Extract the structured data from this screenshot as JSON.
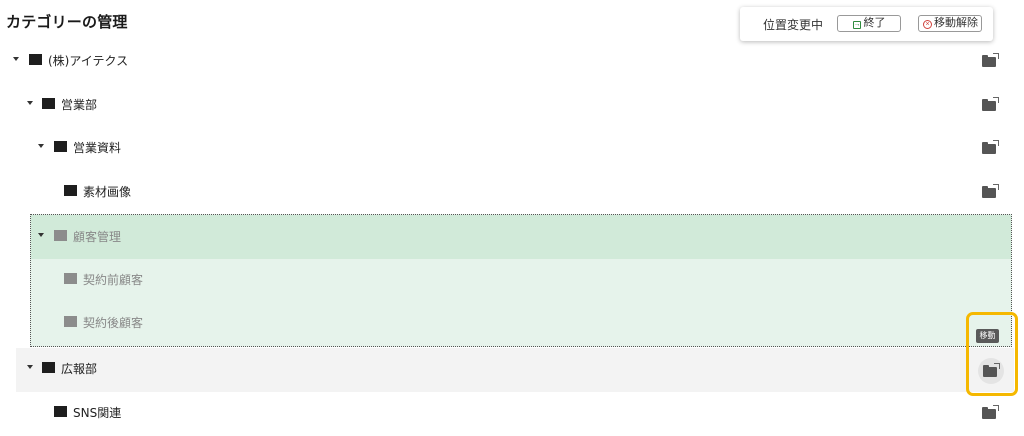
{
  "page": {
    "title": "カテゴリーの管理"
  },
  "toolbar": {
    "status": "位置変更中",
    "end_label": "終了",
    "cancel_label": "移動解除"
  },
  "tree": [
    {
      "label": "(株)アイテクス",
      "depth": 0,
      "expanded": true
    },
    {
      "label": "営業部",
      "depth": 1,
      "expanded": true
    },
    {
      "label": "営業資料",
      "depth": 2,
      "expanded": true
    },
    {
      "label": "素材画像",
      "depth": 3,
      "expanded": false
    },
    {
      "label": "顧客管理",
      "depth": 2,
      "expanded": true,
      "moving": true
    },
    {
      "label": "契約前顧客",
      "depth": 3,
      "moving": true
    },
    {
      "label": "契約後顧客",
      "depth": 3,
      "moving": true
    },
    {
      "label": "広報部",
      "depth": 1,
      "expanded": true,
      "hover": true
    },
    {
      "label": "SNS関連",
      "depth": 2,
      "expanded": false
    }
  ],
  "tooltip": "移動",
  "colors": {
    "folder": "#1e1e1e",
    "folder_dim": "#8c8c8c",
    "moving_bg": "#e6f3eb",
    "highlight": "#f5b800"
  }
}
